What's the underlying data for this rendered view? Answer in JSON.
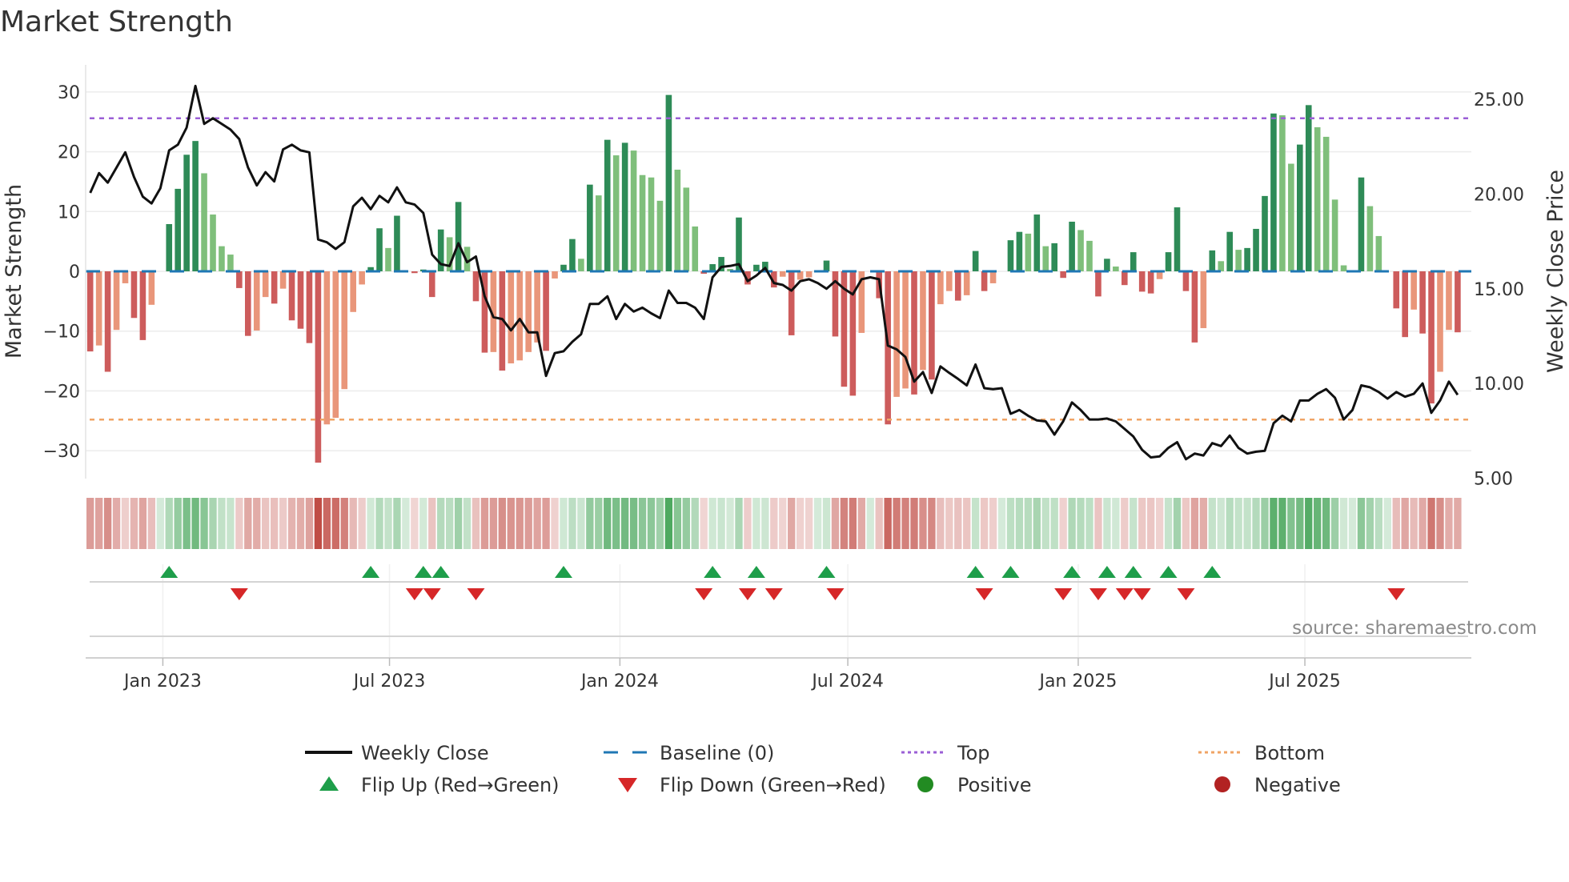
{
  "chart_data": {
    "type": "bar",
    "title": "Market Strength",
    "ylabel": "Market Strength",
    "y2label": "Weekly Close Price",
    "ylim": [
      -34,
      34.5
    ],
    "y2lim": [
      5,
      25
    ],
    "yticks": [
      30,
      20,
      10,
      0,
      -10,
      -20,
      -30
    ],
    "y2ticks": [
      "25.00",
      "20.00",
      "15.00",
      "10.00",
      "5.00"
    ],
    "grid": true,
    "start_date": "2022-11-04",
    "frequency": "weekly",
    "xticks": [
      {
        "label": "Jan 2023",
        "date": "2023-01-01"
      },
      {
        "label": "Jul 2023",
        "date": "2023-07-01"
      },
      {
        "label": "Jan 2024",
        "date": "2024-01-01"
      },
      {
        "label": "Jul 2024",
        "date": "2024-07-01"
      },
      {
        "label": "Jan 2025",
        "date": "2025-01-01"
      },
      {
        "label": "Jul 2025",
        "date": "2025-07-01"
      }
    ],
    "top_level": 25.6,
    "bottom_level": -24.8,
    "baseline": 0,
    "series": [
      {
        "name": "Market Strength",
        "type": "bar",
        "values": [
          -13.4,
          -12.4,
          -16.8,
          -9.8,
          -2.0,
          -7.8,
          -11.5,
          -5.6,
          0,
          7.9,
          13.8,
          19.5,
          21.8,
          16.4,
          9.5,
          4.2,
          2.8,
          -2.8,
          -10.8,
          -9.9,
          -4.3,
          -5.4,
          -2.9,
          -8.2,
          -9.6,
          -12.0,
          -32.0,
          -25.6,
          -24.5,
          -19.7,
          -6.8,
          -2.2,
          0.7,
          7.2,
          3.9,
          9.3,
          0,
          -0.3,
          0.3,
          -4.3,
          7.0,
          5.7,
          11.6,
          4.1,
          -5.0,
          -13.6,
          -13.5,
          -16.6,
          -15.4,
          -14.9,
          -13.5,
          -11.9,
          -13.3,
          -1.2,
          1.1,
          5.4,
          2.1,
          14.5,
          12.7,
          22.0,
          19.4,
          21.5,
          20.2,
          16.1,
          15.7,
          11.8,
          29.5,
          17.0,
          14.0,
          7.5,
          -0.4,
          1.2,
          2.4,
          0.4,
          9.0,
          -2.2,
          1.1,
          1.6,
          -2.7,
          -0.9,
          -10.7,
          -1.4,
          -1.0,
          0,
          1.8,
          -10.9,
          -19.3,
          -20.8,
          -10.3,
          0,
          -4.5,
          -25.6,
          -21.0,
          -19.6,
          -20.6,
          -16.5,
          -18.1,
          -5.5,
          -3.3,
          -4.9,
          -4.0,
          3.4,
          -3.3,
          -2.0,
          0,
          5.2,
          6.6,
          6.3,
          9.5,
          4.2,
          4.7,
          -1.1,
          8.3,
          6.9,
          5.1,
          -4.2,
          2.1,
          0.8,
          -2.3,
          3.2,
          -3.4,
          -3.7,
          -1.3,
          3.2,
          10.7,
          -3.3,
          -11.9,
          -9.5,
          3.5,
          1.7,
          6.6,
          3.6,
          3.9,
          7.1,
          12.6,
          26.4,
          26.1,
          18.0,
          21.2,
          27.8,
          24.1,
          22.5,
          12.0,
          1.0,
          0,
          15.7,
          10.9,
          5.9,
          0,
          -6.2,
          -11.0,
          -6.4,
          -10.4,
          -22.1,
          -16.8,
          -9.8,
          -10.2
        ]
      },
      {
        "name": "Weekly Close",
        "type": "line",
        "axis": "right",
        "values": [
          20.06,
          21.1,
          20.6,
          21.4,
          22.2,
          20.9,
          19.86,
          19.5,
          20.3,
          22.3,
          22.6,
          23.5,
          25.7,
          23.7,
          24.0,
          23.7,
          23.4,
          22.9,
          21.4,
          20.45,
          21.15,
          20.66,
          22.35,
          22.6,
          22.3,
          22.2,
          17.6,
          17.45,
          17.1,
          17.45,
          19.35,
          19.8,
          19.2,
          19.9,
          19.56,
          20.35,
          19.56,
          19.44,
          19.0,
          16.8,
          16.3,
          16.2,
          17.4,
          16.4,
          16.7,
          14.6,
          13.5,
          13.4,
          12.8,
          13.4,
          12.7,
          12.7,
          10.4,
          11.6,
          11.7,
          12.2,
          12.6,
          14.2,
          14.2,
          14.6,
          13.4,
          14.2,
          13.8,
          14.0,
          13.7,
          13.45,
          14.9,
          14.25,
          14.25,
          14.0,
          13.4,
          15.6,
          16.15,
          16.2,
          16.3,
          15.4,
          15.7,
          16.1,
          15.3,
          15.2,
          14.9,
          15.4,
          15.5,
          15.3,
          15.0,
          15.4,
          15.0,
          14.7,
          15.5,
          15.6,
          15.5,
          12.0,
          11.8,
          11.4,
          10.1,
          10.6,
          9.5,
          10.9,
          10.56,
          10.24,
          9.9,
          11.0,
          9.75,
          9.7,
          9.75,
          8.4,
          8.6,
          8.3,
          8.05,
          8.0,
          7.3,
          8.0,
          9.0,
          8.6,
          8.1,
          8.1,
          8.15,
          8.0,
          7.6,
          7.2,
          6.5,
          6.1,
          6.15,
          6.6,
          6.9,
          6.0,
          6.3,
          6.2,
          6.85,
          6.7,
          7.25,
          6.6,
          6.3,
          6.4,
          6.45,
          7.9,
          8.3,
          8.0,
          9.1,
          9.1,
          9.45,
          9.7,
          9.25,
          8.1,
          8.6,
          9.9,
          9.8,
          9.55,
          9.2,
          9.55,
          9.3,
          9.45,
          10.0,
          8.45,
          9.1,
          10.1,
          9.4
        ]
      }
    ],
    "legend": [
      {
        "label": "Weekly Close",
        "kind": "line",
        "color": "#111111"
      },
      {
        "label": "Baseline (0)",
        "kind": "dash",
        "color": "#1f77b4"
      },
      {
        "label": "Top",
        "kind": "dot",
        "color": "#9b5fd6"
      },
      {
        "label": "Bottom",
        "kind": "dot",
        "color": "#f0a466"
      },
      {
        "label": "Flip Up (Red→Green)",
        "kind": "tri-up",
        "color": "#1e9e4a"
      },
      {
        "label": "Flip Down (Green→Red)",
        "kind": "tri-down",
        "color": "#d62728"
      },
      {
        "label": "Positive",
        "kind": "circle",
        "color": "#228b22"
      },
      {
        "label": "Negative",
        "kind": "circle",
        "color": "#b22222"
      }
    ],
    "legend_position": "bottom",
    "colors": {
      "pos_strong": "#2e8b57",
      "pos_weak": "#7fbf7b",
      "neg_strong": "#cd5c5c",
      "neg_weak": "#e9967a",
      "grid": "#ececec",
      "axis": "#cccccc"
    },
    "source": "source: sharemaestro.com"
  }
}
